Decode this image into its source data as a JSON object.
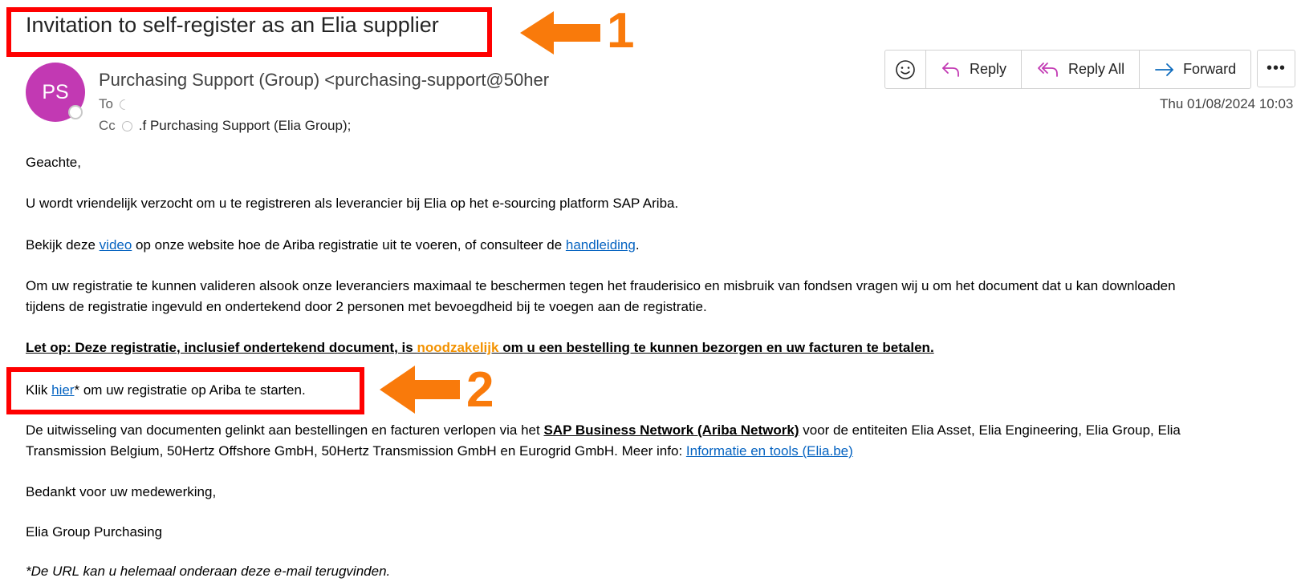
{
  "email": {
    "subject": "Invitation to self-register as an Elia supplier",
    "sender": {
      "initials": "PS",
      "display": "Purchasing Support (Group) <purchasing-support@50her",
      "avatar_color": "#c239b3"
    },
    "to_label": "To",
    "cc_label": "Cc",
    "cc_value": ".f Purchasing Support (Elia Group);",
    "date": "Thu 01/08/2024 10:03"
  },
  "toolbar": {
    "reply": "Reply",
    "reply_all": "Reply All",
    "forward": "Forward",
    "more": "•••"
  },
  "callouts": {
    "one": "1",
    "two": "2",
    "color": "#ff0000",
    "arrow_color": "#f97a0b"
  },
  "body": {
    "greeting": "Geachte,",
    "p1": "U wordt vriendelijk verzocht om u te registreren als leverancier bij Elia op het e-sourcing platform SAP Ariba.",
    "p2_a": "Bekijk deze ",
    "p2_link1": "video",
    "p2_b": " op onze website hoe de Ariba registratie uit te voeren, of consulteer de ",
    "p2_link2": "handleiding",
    "p2_c": ".",
    "p3_line1": "Om uw registratie te kunnen valideren alsook onze leveranciers maximaal te beschermen tegen het frauderisico en misbruik van fondsen vragen wij u om het document dat u kan downloaden",
    "p3_line2": "tijdens de registratie ingevuld en ondertekend door 2 personen met bevoegdheid bij te voegen aan de registratie.",
    "warn_a": "Let op: Deze registratie, inclusief ondertekend document, is ",
    "warn_orange": "noodzakelijk",
    "warn_b": " om u een bestelling te kunnen bezorgen en uw facturen te betalen.",
    "klik_a": "Klik ",
    "klik_link": "hier",
    "klik_b": "* om uw registratie op Ariba te starten.",
    "p5_a": "De uitwisseling van documenten gelinkt aan bestellingen en facturen verlopen via het ",
    "p5_bold": "SAP Business Network (Ariba Network)",
    "p5_b": " voor de entiteiten Elia Asset, Elia Engineering, Elia Group, Elia",
    "p5_line2": "Transmission Belgium, 50Hertz Offshore GmbH, 50Hertz Transmission GmbH en Eurogrid GmbH. Meer info: ",
    "p5_link": "Informatie en tools (Elia.be)",
    "thanks": "Bedankt voor uw medewerking,",
    "signature": "Elia Group Purchasing",
    "footnote": "*De URL kan u helemaal onderaan deze e-mail terugvinden."
  }
}
